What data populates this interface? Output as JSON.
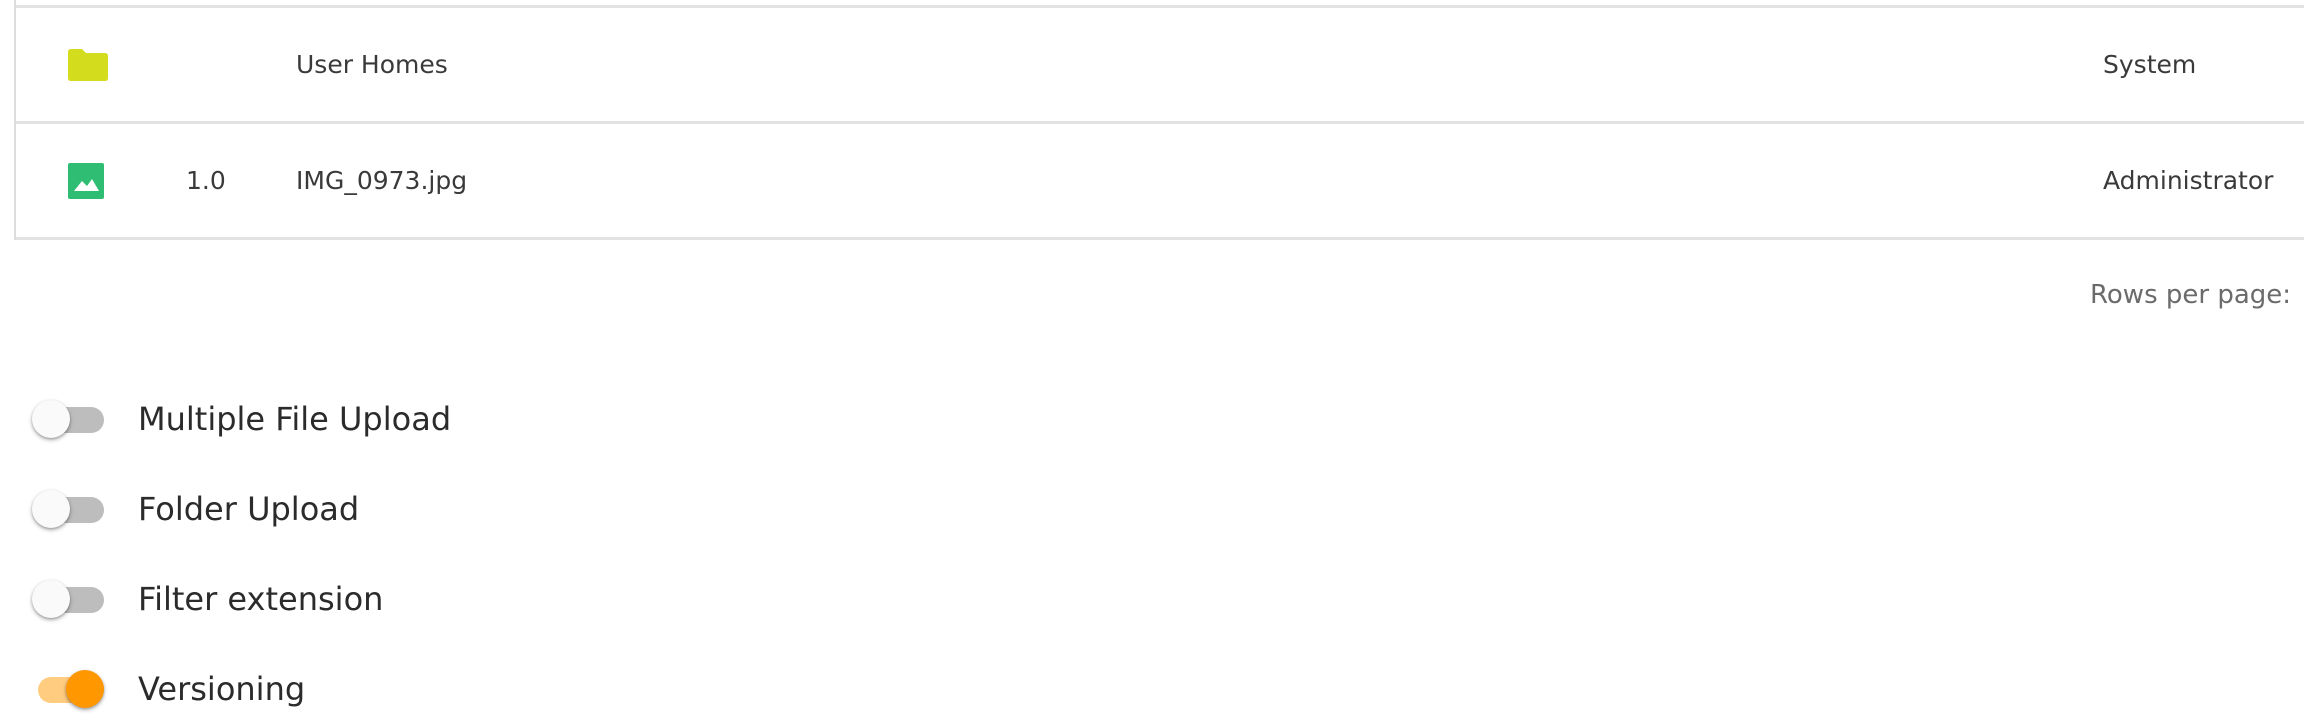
{
  "table": {
    "rows": [
      {
        "icon": "folder-icon",
        "icon_color": "#d4dc1e",
        "version": "",
        "name": "User Homes",
        "owner": "System"
      },
      {
        "icon": "image-icon",
        "icon_color": "#2ebd73",
        "version": "1.0",
        "name": "IMG_0973.jpg",
        "owner": "Administrator"
      }
    ]
  },
  "pagination": {
    "rows_per_page_label": "Rows per page:"
  },
  "options": {
    "accent_color": "#ff9800",
    "toggles": [
      {
        "label": "Multiple File Upload",
        "checked": false
      },
      {
        "label": "Folder Upload",
        "checked": false
      },
      {
        "label": "Filter extension",
        "checked": false
      },
      {
        "label": "Versioning",
        "checked": true
      }
    ]
  }
}
